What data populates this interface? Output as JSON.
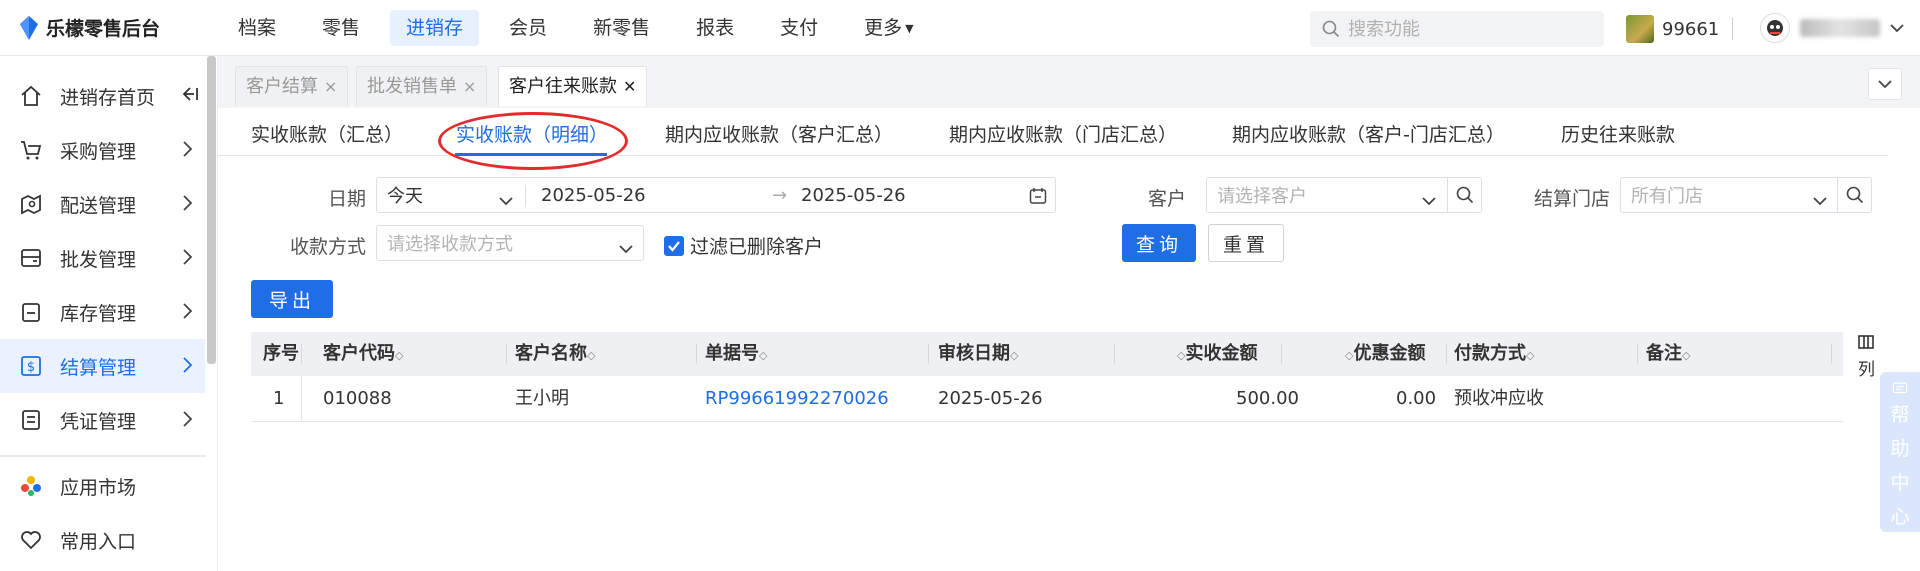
{
  "app": {
    "logo_text": "乐檬零售后台"
  },
  "top_nav": {
    "items": [
      "档案",
      "零售",
      "进销存",
      "会员",
      "新零售",
      "报表",
      "支付",
      "更多"
    ],
    "active_index": 2
  },
  "top_search": {
    "placeholder": "搜索功能"
  },
  "store": {
    "id": "99661"
  },
  "sidebar": {
    "items": [
      {
        "label": "进销存首页",
        "icon": "home-icon"
      },
      {
        "label": "采购管理",
        "icon": "cart-icon"
      },
      {
        "label": "配送管理",
        "icon": "map-pin-icon"
      },
      {
        "label": "批发管理",
        "icon": "wallet-icon"
      },
      {
        "label": "库存管理",
        "icon": "inventory-icon"
      },
      {
        "label": "结算管理",
        "icon": "settlement-icon"
      },
      {
        "label": "凭证管理",
        "icon": "voucher-icon"
      }
    ],
    "active_index": 5,
    "bottom_items": [
      {
        "label": "应用市场",
        "icon": "app-market-icon"
      },
      {
        "label": "常用入口",
        "icon": "heart-icon"
      }
    ]
  },
  "page_tabs": [
    {
      "label": "客户结算",
      "close": "×"
    },
    {
      "label": "批发销售单",
      "close": "×"
    },
    {
      "label": "客户往来账款",
      "close": "✕"
    }
  ],
  "page_tabs_active": 2,
  "sub_tabs": {
    "items": [
      "实收账款（汇总）",
      "实收账款（明细）",
      "期内应收账款（客户汇总）",
      "期内应收账款（门店汇总）",
      "期内应收账款（客户-门店汇总）",
      "历史往来账款"
    ],
    "active_index": 1
  },
  "filters": {
    "date_label": "日期",
    "date_preset": "今天",
    "date_start": "2025-05-26",
    "date_arrow": "→",
    "date_end": "2025-05-26",
    "customer_label": "客户",
    "customer_placeholder": "请选择客户",
    "store_label": "结算门店",
    "store_placeholder": "所有门店",
    "payment_label": "收款方式",
    "payment_placeholder": "请选择收款方式",
    "filter_deleted_label": "过滤已删除客户",
    "filter_deleted_checked": true,
    "query_button": "查询",
    "reset_button": "重置",
    "export_button": "导出"
  },
  "table": {
    "columns": [
      "序号",
      "客户代码",
      "客户名称",
      "单据号",
      "审核日期",
      "实收金额",
      "优惠金额",
      "付款方式",
      "备注"
    ],
    "rows": [
      [
        "1",
        "010088",
        "王小明",
        "RP99661992270026",
        "2025-05-26",
        "500.00",
        "0.00",
        "预收冲应收",
        ""
      ]
    ]
  },
  "column_tool_label": "列",
  "help_widget": {
    "chars": [
      "帮",
      "助",
      "中",
      "心"
    ]
  },
  "colors": {
    "accent": "#1f6ee8",
    "annotation": "#e22b2b",
    "active_bg": "#eaf2ff"
  }
}
